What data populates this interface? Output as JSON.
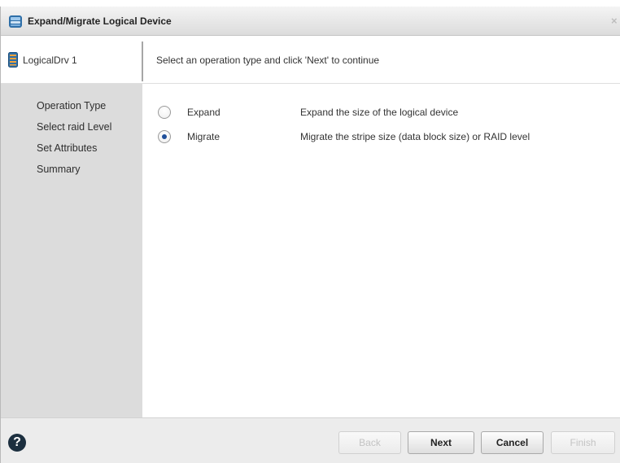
{
  "window": {
    "title": "Expand/Migrate Logical Device",
    "close_glyph": "×",
    "title_icon": "server-icon"
  },
  "header": {
    "device_name": "LogicalDrv 1",
    "device_icon": "logical-drive-icon",
    "instruction": "Select an operation type and click 'Next' to continue"
  },
  "steps": [
    {
      "label": "Operation Type",
      "active": true
    },
    {
      "label": "Select raid Level",
      "active": false
    },
    {
      "label": "Set Attributes",
      "active": false
    },
    {
      "label": "Summary",
      "active": false
    }
  ],
  "options": [
    {
      "label": "Expand",
      "description": "Expand the size of the logical device",
      "selected": false
    },
    {
      "label": "Migrate",
      "description": "Migrate the stripe size (data block size) or RAID level",
      "selected": true
    }
  ],
  "footer": {
    "help_glyph": "?",
    "buttons": {
      "back": {
        "label": "Back",
        "enabled": false
      },
      "next": {
        "label": "Next",
        "enabled": true
      },
      "cancel": {
        "label": "Cancel",
        "enabled": true
      },
      "finish": {
        "label": "Finish",
        "enabled": false
      }
    }
  },
  "colors": {
    "sidebar_bg": "#dcdcdc",
    "footer_bg": "#ececec",
    "radio_selected": "#1f4f9a",
    "help_icon_bg": "#1c2f3f"
  }
}
